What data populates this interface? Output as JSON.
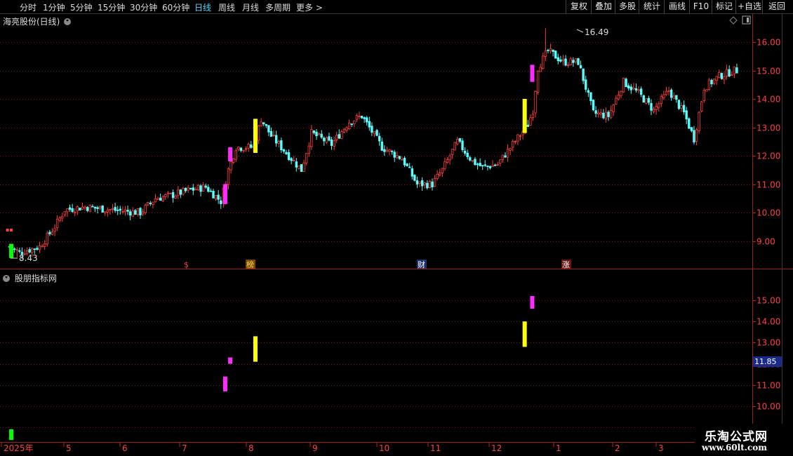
{
  "toolbar": {
    "periods": [
      "分时",
      "1分钟",
      "5分钟",
      "15分钟",
      "30分钟",
      "60分钟",
      "日线",
      "周线",
      "月线",
      "多周期",
      "更多 >"
    ],
    "active_period": "日线",
    "buttons": [
      "复权",
      "叠加",
      "多股",
      "统计",
      "画线",
      "F10",
      "标记",
      "+自选",
      "返回"
    ]
  },
  "main_panel": {
    "title": "海亮股份(日线)",
    "high_label": "16.49",
    "low_label": "8.43"
  },
  "indicator_panel": {
    "title": "股朋指标网",
    "current_value": "11.85"
  },
  "event_markers": [
    "$",
    "榜",
    "财",
    "涨"
  ],
  "axis": {
    "main_ticks": [
      "16.00",
      "15.00",
      "14.00",
      "13.00",
      "12.00",
      "11.00",
      "10.00",
      "9.00"
    ],
    "ind_ticks": [
      "15.00",
      "14.00",
      "13.00",
      "12.00",
      "11.00",
      "10.00"
    ],
    "months": [
      "2025年",
      "5",
      "6",
      "7",
      "8",
      "9",
      "10",
      "11",
      "12",
      "1",
      "2",
      "3"
    ]
  },
  "watermark": {
    "line1": "乐淘公式网",
    "line2": "www.60lt.com"
  },
  "colors": {
    "up": "#ff3c3c",
    "down": "#54ffff",
    "magenta": "#ff2cff",
    "yellow": "#ffff00",
    "green": "#00ff00",
    "grid": "#7a1c1c",
    "active": "#4fd6ff"
  },
  "chart_data": {
    "type": "candlestick",
    "main": {
      "ylim": [
        8.2,
        16.9
      ],
      "ticks": [
        16,
        15,
        14,
        13,
        12,
        11,
        10,
        9
      ],
      "anchors": [
        [
          0,
          8.8
        ],
        [
          4,
          8.6
        ],
        [
          12,
          8.8
        ],
        [
          18,
          9.5
        ],
        [
          22,
          10.1
        ],
        [
          30,
          10.2
        ],
        [
          40,
          10.1
        ],
        [
          52,
          10.0
        ],
        [
          58,
          10.5
        ],
        [
          64,
          10.6
        ],
        [
          72,
          10.8
        ],
        [
          78,
          10.9
        ],
        [
          84,
          10.4
        ],
        [
          87,
          11.5
        ],
        [
          90,
          12.3
        ],
        [
          97,
          12.3
        ],
        [
          100,
          13.3
        ],
        [
          104,
          12.7
        ],
        [
          110,
          12.1
        ],
        [
          116,
          11.5
        ],
        [
          120,
          12.8
        ],
        [
          128,
          12.4
        ],
        [
          135,
          13.2
        ],
        [
          140,
          13.4
        ],
        [
          148,
          12.3
        ],
        [
          156,
          11.9
        ],
        [
          162,
          11.0
        ],
        [
          168,
          11.0
        ],
        [
          172,
          11.5
        ],
        [
          178,
          12.5
        ],
        [
          184,
          11.8
        ],
        [
          188,
          11.6
        ],
        [
          194,
          11.7
        ],
        [
          200,
          12.4
        ],
        [
          206,
          13.1
        ],
        [
          208,
          13.6
        ],
        [
          210,
          15.1
        ],
        [
          214,
          15.7
        ],
        [
          220,
          15.3
        ],
        [
          226,
          15.3
        ],
        [
          232,
          13.5
        ],
        [
          238,
          13.4
        ],
        [
          244,
          14.6
        ],
        [
          250,
          14.2
        ],
        [
          256,
          13.6
        ],
        [
          262,
          14.3
        ],
        [
          268,
          13.5
        ],
        [
          272,
          12.6
        ],
        [
          276,
          14.4
        ],
        [
          282,
          14.8
        ],
        [
          288,
          15.0
        ]
      ],
      "high": 16.49,
      "low": 8.43
    },
    "signals": [
      {
        "type": "green",
        "x": 1,
        "main": [
          8.4,
          8.9
        ],
        "ind": [
          9.7,
          10.2
        ]
      },
      {
        "type": "magenta",
        "x": 86,
        "main": [
          10.3,
          11.0
        ],
        "ind": [
          10.7,
          11.4
        ]
      },
      {
        "type": "magenta",
        "x": 88,
        "main": [
          11.8,
          12.3
        ],
        "ind": [
          12.0,
          12.3
        ]
      },
      {
        "type": "yellow",
        "x": 98,
        "main": [
          12.1,
          13.3
        ],
        "ind": [
          12.1,
          13.3
        ]
      },
      {
        "type": "yellow",
        "x": 205,
        "main": [
          12.8,
          14.0
        ],
        "ind": [
          12.8,
          14.0
        ]
      },
      {
        "type": "magenta",
        "x": 208,
        "main": [
          14.6,
          15.2
        ],
        "ind": [
          14.6,
          15.2
        ]
      }
    ],
    "indicator": {
      "ylim": [
        9.5,
        16.5
      ],
      "ticks": [
        15,
        14,
        13,
        12,
        11,
        10
      ],
      "current": 11.85
    }
  }
}
